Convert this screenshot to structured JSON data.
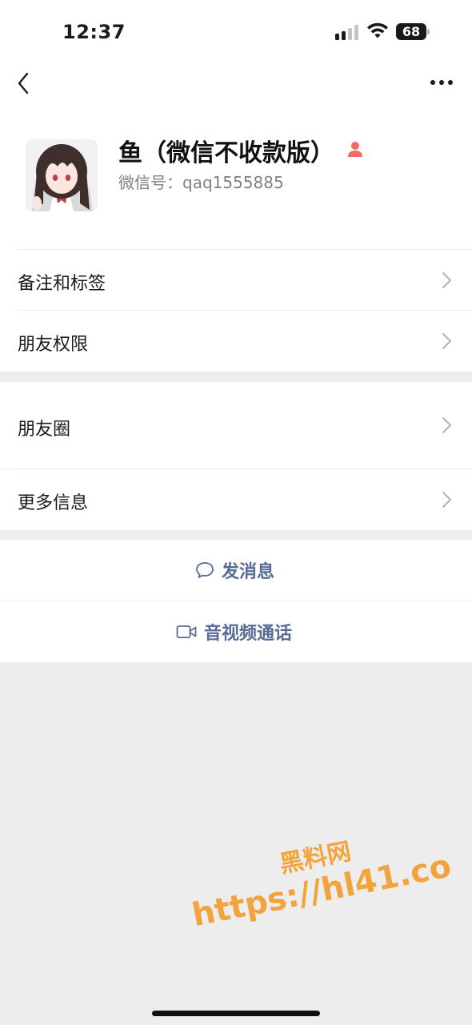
{
  "status_bar": {
    "time": "12:37",
    "battery": "68"
  },
  "nav": {
    "back_icon": "chevron-left-icon",
    "more_icon": "more-dots-icon"
  },
  "profile": {
    "name": "鱼（微信不收款版）",
    "wechat_id": "微信号：qaq1555885",
    "gender_icon": "person-icon",
    "gender_color": "#f46b60"
  },
  "menu": {
    "group1": [
      {
        "label": "备注和标签"
      },
      {
        "label": "朋友权限"
      }
    ],
    "group2": [
      {
        "label": "朋友圈"
      },
      {
        "label": "更多信息"
      }
    ]
  },
  "actions": {
    "message": {
      "label": "发消息",
      "icon": "chat-bubble-icon"
    },
    "video_call": {
      "label": "音视频通话",
      "icon": "video-camera-icon"
    },
    "color": "#576b95"
  },
  "watermark": {
    "line1": "黑料网",
    "line2": "https://hl41.co"
  }
}
